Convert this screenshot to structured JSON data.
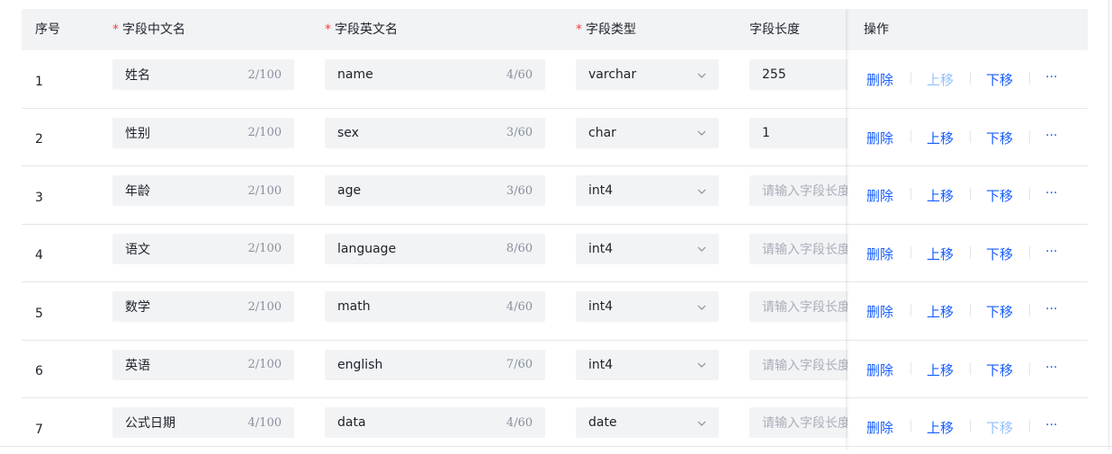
{
  "columns": {
    "index": "序号",
    "cn_name": "字段中文名",
    "en_name": "字段英文名",
    "type": "字段类型",
    "length": "字段长度",
    "actions": "操作"
  },
  "required_mark": "*",
  "actions": {
    "delete": "删除",
    "move_up": "上移",
    "move_down": "下移",
    "more": "···"
  },
  "length_placeholder": "请输入字段长度",
  "rows": [
    {
      "index": "1",
      "cn": "姓名",
      "cn_count": "2/100",
      "en": "name",
      "en_count": "4/60",
      "type": "varchar",
      "length": "255",
      "up_disabled": true,
      "down_disabled": false
    },
    {
      "index": "2",
      "cn": "性别",
      "cn_count": "2/100",
      "en": "sex",
      "en_count": "3/60",
      "type": "char",
      "length": "1",
      "up_disabled": false,
      "down_disabled": false
    },
    {
      "index": "3",
      "cn": "年龄",
      "cn_count": "2/100",
      "en": "age",
      "en_count": "3/60",
      "type": "int4",
      "length": "",
      "up_disabled": false,
      "down_disabled": false
    },
    {
      "index": "4",
      "cn": "语文",
      "cn_count": "2/100",
      "en": "language",
      "en_count": "8/60",
      "type": "int4",
      "length": "",
      "up_disabled": false,
      "down_disabled": false
    },
    {
      "index": "5",
      "cn": "数学",
      "cn_count": "2/100",
      "en": "math",
      "en_count": "4/60",
      "type": "int4",
      "length": "",
      "up_disabled": false,
      "down_disabled": false
    },
    {
      "index": "6",
      "cn": "英语",
      "cn_count": "2/100",
      "en": "english",
      "en_count": "7/60",
      "type": "int4",
      "length": "",
      "up_disabled": false,
      "down_disabled": false
    },
    {
      "index": "7",
      "cn": "公式日期",
      "cn_count": "4/100",
      "en": "data",
      "en_count": "4/60",
      "type": "date",
      "length": "",
      "up_disabled": false,
      "down_disabled": true
    }
  ]
}
